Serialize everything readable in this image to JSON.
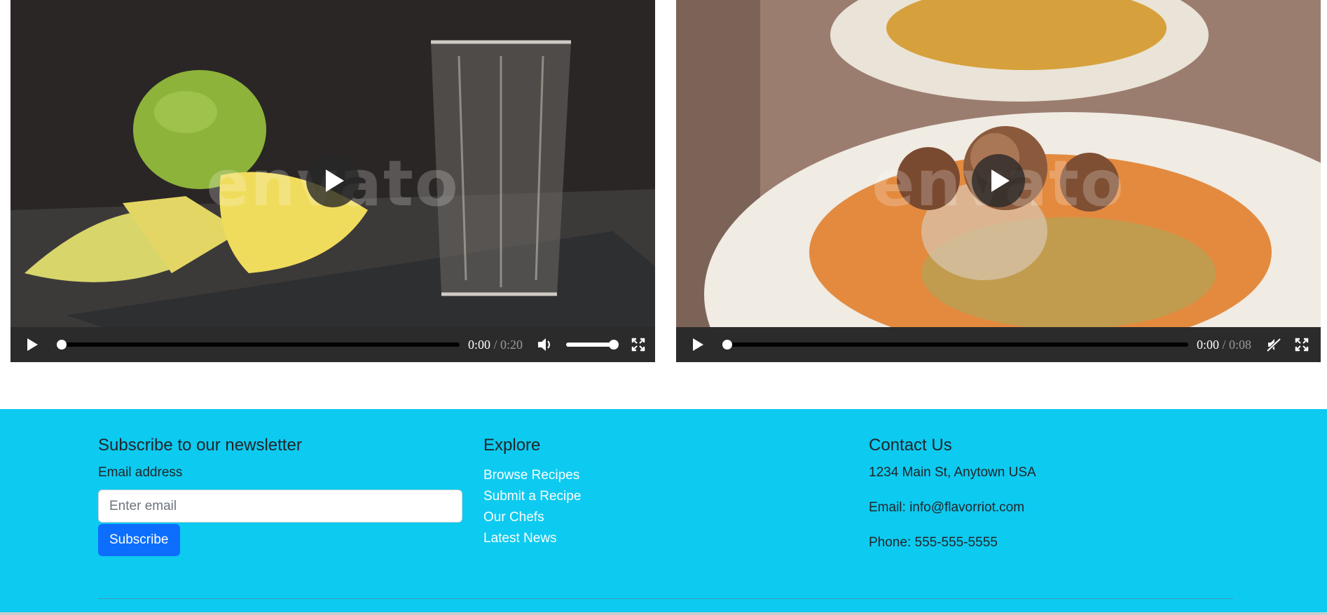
{
  "videos": [
    {
      "current_time": "0:00",
      "separator": "/",
      "duration": "0:20",
      "watermark": "envato",
      "muted": false
    },
    {
      "current_time": "0:00",
      "separator": "/",
      "duration": "0:08",
      "watermark": "envato",
      "muted": true
    }
  ],
  "newsletter": {
    "heading": "Subscribe to our newsletter",
    "email_label": "Email address",
    "email_placeholder": "Enter email",
    "subscribe_label": "Subscribe"
  },
  "explore": {
    "heading": "Explore",
    "links": [
      "Browse Recipes",
      "Submit a Recipe",
      "Our Chefs",
      "Latest News"
    ]
  },
  "contact": {
    "heading": "Contact Us",
    "address": "1234 Main St, Anytown USA",
    "email": "Email: info@flavorriot.com",
    "phone": "Phone: 555-555-5555"
  },
  "colors": {
    "footer_bg": "#0dcaf0",
    "button": "#0d6efd"
  }
}
